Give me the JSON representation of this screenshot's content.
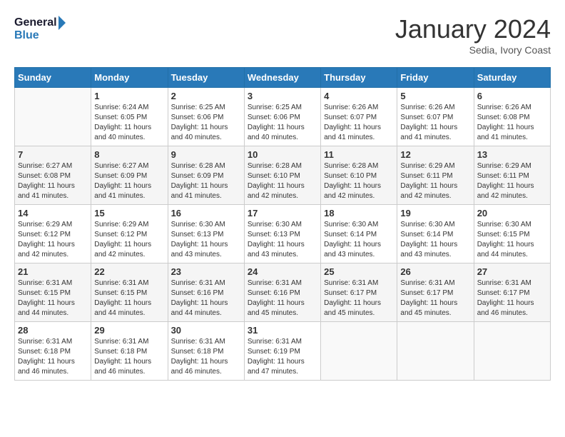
{
  "header": {
    "logo_text_general": "General",
    "logo_text_blue": "Blue",
    "month_year": "January 2024",
    "location": "Sedia, Ivory Coast"
  },
  "weekdays": [
    "Sunday",
    "Monday",
    "Tuesday",
    "Wednesday",
    "Thursday",
    "Friday",
    "Saturday"
  ],
  "weeks": [
    [
      {
        "day": "",
        "info": ""
      },
      {
        "day": "1",
        "info": "Sunrise: 6:24 AM\nSunset: 6:05 PM\nDaylight: 11 hours\nand 40 minutes."
      },
      {
        "day": "2",
        "info": "Sunrise: 6:25 AM\nSunset: 6:06 PM\nDaylight: 11 hours\nand 40 minutes."
      },
      {
        "day": "3",
        "info": "Sunrise: 6:25 AM\nSunset: 6:06 PM\nDaylight: 11 hours\nand 40 minutes."
      },
      {
        "day": "4",
        "info": "Sunrise: 6:26 AM\nSunset: 6:07 PM\nDaylight: 11 hours\nand 41 minutes."
      },
      {
        "day": "5",
        "info": "Sunrise: 6:26 AM\nSunset: 6:07 PM\nDaylight: 11 hours\nand 41 minutes."
      },
      {
        "day": "6",
        "info": "Sunrise: 6:26 AM\nSunset: 6:08 PM\nDaylight: 11 hours\nand 41 minutes."
      }
    ],
    [
      {
        "day": "7",
        "info": "Sunrise: 6:27 AM\nSunset: 6:08 PM\nDaylight: 11 hours\nand 41 minutes."
      },
      {
        "day": "8",
        "info": "Sunrise: 6:27 AM\nSunset: 6:09 PM\nDaylight: 11 hours\nand 41 minutes."
      },
      {
        "day": "9",
        "info": "Sunrise: 6:28 AM\nSunset: 6:09 PM\nDaylight: 11 hours\nand 41 minutes."
      },
      {
        "day": "10",
        "info": "Sunrise: 6:28 AM\nSunset: 6:10 PM\nDaylight: 11 hours\nand 42 minutes."
      },
      {
        "day": "11",
        "info": "Sunrise: 6:28 AM\nSunset: 6:10 PM\nDaylight: 11 hours\nand 42 minutes."
      },
      {
        "day": "12",
        "info": "Sunrise: 6:29 AM\nSunset: 6:11 PM\nDaylight: 11 hours\nand 42 minutes."
      },
      {
        "day": "13",
        "info": "Sunrise: 6:29 AM\nSunset: 6:11 PM\nDaylight: 11 hours\nand 42 minutes."
      }
    ],
    [
      {
        "day": "14",
        "info": "Sunrise: 6:29 AM\nSunset: 6:12 PM\nDaylight: 11 hours\nand 42 minutes."
      },
      {
        "day": "15",
        "info": "Sunrise: 6:29 AM\nSunset: 6:12 PM\nDaylight: 11 hours\nand 42 minutes."
      },
      {
        "day": "16",
        "info": "Sunrise: 6:30 AM\nSunset: 6:13 PM\nDaylight: 11 hours\nand 43 minutes."
      },
      {
        "day": "17",
        "info": "Sunrise: 6:30 AM\nSunset: 6:13 PM\nDaylight: 11 hours\nand 43 minutes."
      },
      {
        "day": "18",
        "info": "Sunrise: 6:30 AM\nSunset: 6:14 PM\nDaylight: 11 hours\nand 43 minutes."
      },
      {
        "day": "19",
        "info": "Sunrise: 6:30 AM\nSunset: 6:14 PM\nDaylight: 11 hours\nand 43 minutes."
      },
      {
        "day": "20",
        "info": "Sunrise: 6:30 AM\nSunset: 6:15 PM\nDaylight: 11 hours\nand 44 minutes."
      }
    ],
    [
      {
        "day": "21",
        "info": "Sunrise: 6:31 AM\nSunset: 6:15 PM\nDaylight: 11 hours\nand 44 minutes."
      },
      {
        "day": "22",
        "info": "Sunrise: 6:31 AM\nSunset: 6:15 PM\nDaylight: 11 hours\nand 44 minutes."
      },
      {
        "day": "23",
        "info": "Sunrise: 6:31 AM\nSunset: 6:16 PM\nDaylight: 11 hours\nand 44 minutes."
      },
      {
        "day": "24",
        "info": "Sunrise: 6:31 AM\nSunset: 6:16 PM\nDaylight: 11 hours\nand 45 minutes."
      },
      {
        "day": "25",
        "info": "Sunrise: 6:31 AM\nSunset: 6:17 PM\nDaylight: 11 hours\nand 45 minutes."
      },
      {
        "day": "26",
        "info": "Sunrise: 6:31 AM\nSunset: 6:17 PM\nDaylight: 11 hours\nand 45 minutes."
      },
      {
        "day": "27",
        "info": "Sunrise: 6:31 AM\nSunset: 6:17 PM\nDaylight: 11 hours\nand 46 minutes."
      }
    ],
    [
      {
        "day": "28",
        "info": "Sunrise: 6:31 AM\nSunset: 6:18 PM\nDaylight: 11 hours\nand 46 minutes."
      },
      {
        "day": "29",
        "info": "Sunrise: 6:31 AM\nSunset: 6:18 PM\nDaylight: 11 hours\nand 46 minutes."
      },
      {
        "day": "30",
        "info": "Sunrise: 6:31 AM\nSunset: 6:18 PM\nDaylight: 11 hours\nand 46 minutes."
      },
      {
        "day": "31",
        "info": "Sunrise: 6:31 AM\nSunset: 6:19 PM\nDaylight: 11 hours\nand 47 minutes."
      },
      {
        "day": "",
        "info": ""
      },
      {
        "day": "",
        "info": ""
      },
      {
        "day": "",
        "info": ""
      }
    ]
  ]
}
